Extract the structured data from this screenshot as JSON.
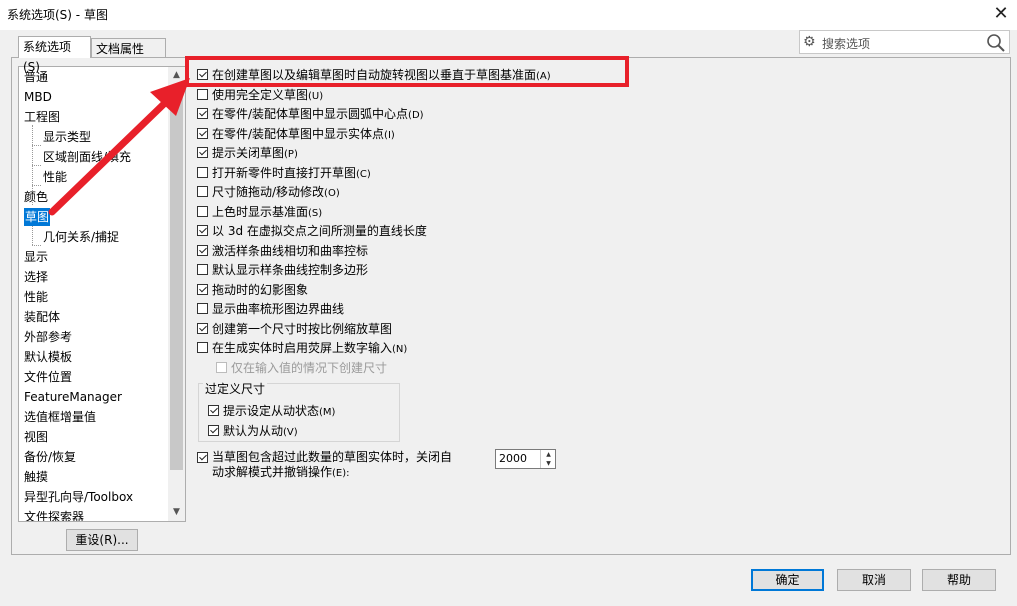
{
  "window": {
    "title": "系统选项(S) - 草图",
    "close_glyph": "✕"
  },
  "tabs": [
    {
      "label": "系统选项(S)",
      "active": true
    },
    {
      "label": "文档属性(D)",
      "active": false
    }
  ],
  "search": {
    "placeholder": "搜索选项",
    "gear_icon": "⚙",
    "search_icon": "🔍"
  },
  "tree": {
    "items": [
      {
        "label": "普通",
        "level": 0
      },
      {
        "label": "MBD",
        "level": 0
      },
      {
        "label": "工程图",
        "level": 0
      },
      {
        "label": "显示类型",
        "level": 1
      },
      {
        "label": "区域剖面线/填充",
        "level": 1
      },
      {
        "label": "性能",
        "level": 1
      },
      {
        "label": "颜色",
        "level": 0
      },
      {
        "label": "草图",
        "level": 0,
        "selected": true
      },
      {
        "label": "几何关系/捕捉",
        "level": 1
      },
      {
        "label": "显示",
        "level": 0
      },
      {
        "label": "选择",
        "level": 0
      },
      {
        "label": "性能",
        "level": 0
      },
      {
        "label": "装配体",
        "level": 0
      },
      {
        "label": "外部参考",
        "level": 0
      },
      {
        "label": "默认模板",
        "level": 0
      },
      {
        "label": "文件位置",
        "level": 0
      },
      {
        "label": "FeatureManager",
        "level": 0
      },
      {
        "label": "选值框增量值",
        "level": 0
      },
      {
        "label": "视图",
        "level": 0
      },
      {
        "label": "备份/恢复",
        "level": 0
      },
      {
        "label": "触摸",
        "level": 0
      },
      {
        "label": "异型孔向导/Toolbox",
        "level": 0
      },
      {
        "label": "文件探索器",
        "level": 0
      }
    ],
    "scroll_up": "▲",
    "scroll_down": "▼"
  },
  "reset_button": "重设(R)...",
  "options": [
    {
      "label": "在创建草图以及编辑草图时自动旋转视图以垂直于草图基准面",
      "hotkey": "(A)",
      "checked": true
    },
    {
      "label": "使用完全定义草图",
      "hotkey": "(U)",
      "checked": false
    },
    {
      "label": "在零件/装配体草图中显示圆弧中心点",
      "hotkey": "(D)",
      "checked": true
    },
    {
      "label": "在零件/装配体草图中显示实体点",
      "hotkey": "(I)",
      "checked": true
    },
    {
      "label": "提示关闭草图",
      "hotkey": "(P)",
      "checked": true
    },
    {
      "label": "打开新零件时直接打开草图",
      "hotkey": "(C)",
      "checked": false
    },
    {
      "label": "尺寸随拖动/移动修改",
      "hotkey": "(O)",
      "checked": false
    },
    {
      "label": "上色时显示基准面",
      "hotkey": "(S)",
      "checked": false
    },
    {
      "label": "以 3d 在虚拟交点之间所测量的直线长度",
      "hotkey": "",
      "checked": true
    },
    {
      "label": "激活样条曲线相切和曲率控标",
      "hotkey": "",
      "checked": true
    },
    {
      "label": "默认显示样条曲线控制多边形",
      "hotkey": "",
      "checked": false
    },
    {
      "label": "拖动时的幻影图象",
      "hotkey": "",
      "checked": true
    },
    {
      "label": "显示曲率梳形图边界曲线",
      "hotkey": "",
      "checked": false
    },
    {
      "label": "创建第一个尺寸时按比例缩放草图",
      "hotkey": "",
      "checked": true
    },
    {
      "label": "在生成实体时启用荧屏上数字输入",
      "hotkey": "(N)",
      "checked": false
    }
  ],
  "sub_option": {
    "label": "仅在输入值的情况下创建尺寸",
    "checked": false,
    "disabled": true
  },
  "overdefined": {
    "title": "过定义尺寸",
    "items": [
      {
        "label": "提示设定从动状态",
        "hotkey": "(M)",
        "checked": true
      },
      {
        "label": "默认为从动",
        "hotkey": "(V)",
        "checked": true
      }
    ]
  },
  "limit_option": {
    "line1": "当草图包含超过此数量的草图实体时，关闭自",
    "line2": "动求解模式并撤销操作",
    "hotkey": "(E):",
    "checked": true,
    "value": "2000"
  },
  "footer": {
    "ok": "确定",
    "cancel": "取消",
    "help": "帮助"
  },
  "annotation": {
    "color": "#e8202a"
  }
}
